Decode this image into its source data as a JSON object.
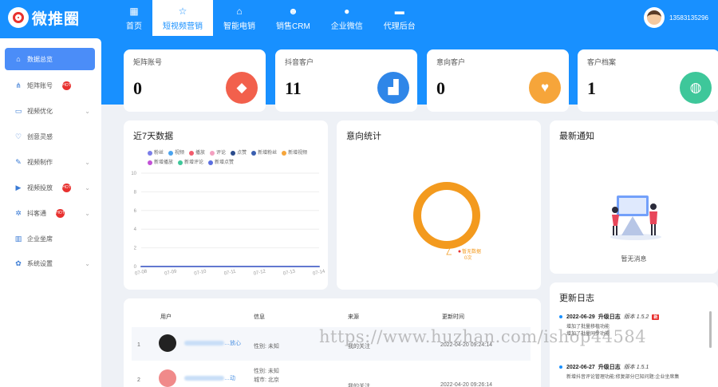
{
  "app": {
    "logo_text": "微推圈"
  },
  "nav": {
    "items": [
      {
        "label": "首页",
        "icon": "home-icon",
        "glyph": "▦"
      },
      {
        "label": "短视频营销",
        "icon": "star-icon",
        "glyph": "☆"
      },
      {
        "label": "智能电销",
        "icon": "robot-icon",
        "glyph": "⌂"
      },
      {
        "label": "销售CRM",
        "icon": "team-icon",
        "glyph": "☻"
      },
      {
        "label": "企业微信",
        "icon": "person-icon",
        "glyph": "●"
      },
      {
        "label": "代理后台",
        "icon": "monitor-icon",
        "glyph": "▬"
      }
    ],
    "active_index": 1
  },
  "user": {
    "phone": "13583135296"
  },
  "sidebar": {
    "items": [
      {
        "label": "数据总览",
        "icon": "home-icon",
        "glyph": "⌂",
        "hot": "",
        "chevron": false
      },
      {
        "label": "矩阵账号",
        "icon": "network-icon",
        "glyph": "⋔",
        "hot": "HOT",
        "chevron": false
      },
      {
        "label": "视频优化",
        "icon": "monitor-icon",
        "glyph": "▭",
        "hot": "",
        "chevron": true
      },
      {
        "label": "创意灵感",
        "icon": "heart-hand-icon",
        "glyph": "♡",
        "hot": "",
        "chevron": false
      },
      {
        "label": "视频制作",
        "icon": "pen-icon",
        "glyph": "✎",
        "hot": "",
        "chevron": true
      },
      {
        "label": "视频投放",
        "icon": "play-icon",
        "glyph": "▶",
        "hot": "HOT",
        "chevron": true
      },
      {
        "label": "抖客通",
        "icon": "gear-icon",
        "glyph": "✲",
        "hot": "HOT",
        "chevron": true
      },
      {
        "label": "企业坐席",
        "icon": "building-icon",
        "glyph": "▥",
        "hot": "",
        "chevron": false
      },
      {
        "label": "系统设置",
        "icon": "settings-icon",
        "glyph": "✿",
        "hot": "",
        "chevron": true
      }
    ]
  },
  "stats": [
    {
      "label": "矩阵账号",
      "value": "0",
      "icon": "diamond-icon",
      "glyph": "◆",
      "color": "#f2604c"
    },
    {
      "label": "抖音客户",
      "value": "11",
      "icon": "picture-icon",
      "glyph": "▟",
      "color": "#2f86e8"
    },
    {
      "label": "意向客户",
      "value": "0",
      "icon": "chat-heart-icon",
      "glyph": "♥",
      "color": "#f6a53a"
    },
    {
      "label": "客户档案",
      "value": "1",
      "icon": "audio-icon",
      "glyph": "◍",
      "color": "#3ec79a"
    }
  ],
  "panels": {
    "trend_title": "近7天数据",
    "intent_title": "意向统计",
    "notice_title": "最新通知",
    "notice_empty": "暂无消息",
    "log_title": "更新日志"
  },
  "chart_data": [
    {
      "type": "line",
      "title": "近7天数据",
      "x": [
        "07-08",
        "07-09",
        "07-10",
        "07-11",
        "07-12",
        "07-13",
        "07-14"
      ],
      "yticks": [
        0,
        2,
        4,
        6,
        8,
        10
      ],
      "ylim": [
        0,
        10
      ],
      "series": [
        {
          "name": "粉丝",
          "color": "#7b7ee8",
          "values": [
            0,
            0,
            0,
            0,
            0,
            0,
            0
          ]
        },
        {
          "name": "视频",
          "color": "#4aa3ee",
          "values": [
            0,
            0,
            0,
            0,
            0,
            0,
            0
          ]
        },
        {
          "name": "播放",
          "color": "#f25b6c",
          "values": [
            0,
            0,
            0,
            0,
            0,
            0,
            0
          ]
        },
        {
          "name": "评论",
          "color": "#f3a0c0",
          "values": [
            0,
            0,
            0,
            0,
            0,
            0,
            0
          ]
        },
        {
          "name": "点赞",
          "color": "#2b4b8c",
          "values": [
            0,
            0,
            0,
            0,
            0,
            0,
            0
          ]
        },
        {
          "name": "新增粉丝",
          "color": "#3a5fb0",
          "values": [
            0,
            0,
            0,
            0,
            0,
            0,
            0
          ]
        },
        {
          "name": "新增视频",
          "color": "#f6a53a",
          "values": [
            0,
            0,
            0,
            0,
            0,
            0,
            0
          ]
        },
        {
          "name": "新增播放",
          "color": "#c251d6",
          "values": [
            0,
            0,
            0,
            0,
            0,
            0,
            0
          ]
        },
        {
          "name": "新增评论",
          "color": "#3ec79a",
          "values": [
            0,
            0,
            0,
            0,
            0,
            0,
            0
          ]
        },
        {
          "name": "新增点赞",
          "color": "#5a6ee0",
          "values": [
            0,
            0,
            0,
            0,
            0,
            0,
            0
          ]
        }
      ],
      "legend": "top"
    },
    {
      "type": "pie",
      "title": "意向统计",
      "labels": [
        "暂无数据"
      ],
      "values": [
        0
      ],
      "value_label": "0次",
      "color": "#f39a1e"
    }
  ],
  "table": {
    "headers": [
      "用户",
      "信息",
      "来源",
      "更新时间"
    ],
    "rows": [
      {
        "index": "1",
        "name": "…放心",
        "info": [
          "性别: 未知"
        ],
        "source": "我的关注",
        "time": "2022-04-20 09:24:14"
      },
      {
        "index": "2",
        "name": "…动",
        "info": [
          "性别: 未知",
          "城市: 北京"
        ],
        "source": "我的关注",
        "time": "2022-04-20 09:26:14"
      }
    ]
  },
  "logs": [
    {
      "date": "2022-06-29",
      "title": "升级日志",
      "version": "版本 1.5.2",
      "badge": "新",
      "lines": [
        "增加了批量移植功能",
        "增加了批量同步功能"
      ]
    },
    {
      "date": "2022-06-27",
      "title": "升级日志",
      "version": "版本 1.5.1",
      "badge": "",
      "lines": [
        "新增抖音评论管理功能:修复部分已知问题:企业坐席集"
      ]
    }
  ],
  "watermark": "https://www.huzhan.com/ishop44584"
}
